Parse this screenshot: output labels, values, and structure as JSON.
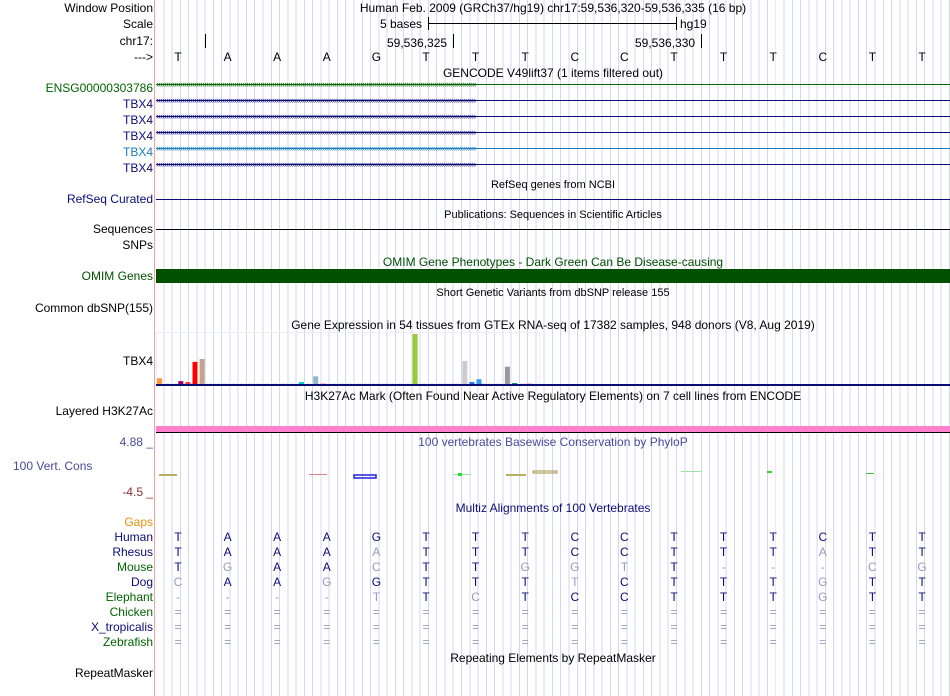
{
  "header": {
    "window_position_label": "Window Position",
    "position_text": "Human Feb. 2009 (GRCh37/hg19)   chr17:59,536,320-59,536,335 (16 bp)",
    "scale_label": "Scale",
    "scale_text": "5 bases",
    "assembly": "hg19",
    "chrom_label": "chr17:",
    "tick1": "59,536,325",
    "tick2": "59,536,330",
    "strand_label": "--->"
  },
  "sequence": "TAAAGTTTCCTTTCTT",
  "gencode": {
    "title": "GENCODE V49lift37 (1 items filtered out)",
    "items": [
      {
        "name": "ENSG00000303786",
        "color": "#006400",
        "strand": "-"
      },
      {
        "name": "TBX4",
        "color": "#0c0c78",
        "strand": "+"
      },
      {
        "name": "TBX4",
        "color": "#0c0c78",
        "strand": "+"
      },
      {
        "name": "TBX4",
        "color": "#0c0c78",
        "strand": "+"
      },
      {
        "name": "TBX4",
        "color": "#1a7cc0",
        "strand": "+"
      },
      {
        "name": "TBX4",
        "color": "#0c0c78",
        "strand": "+"
      }
    ]
  },
  "refseq": {
    "title": "RefSeq genes from NCBI",
    "label": "RefSeq Curated"
  },
  "publications": {
    "title": "Publications: Sequences in Scientific Articles",
    "label": "Sequences"
  },
  "snps": {
    "label": "SNPs"
  },
  "omim": {
    "title": "OMIM Gene Phenotypes - Dark Green Can Be Disease-causing",
    "label": "OMIM Genes",
    "color": "#005000"
  },
  "dbsnp": {
    "title": "Short Genetic Variants from dbSNP release 155",
    "label": "Common dbSNP(155)"
  },
  "gtex": {
    "title": "Gene Expression in 54 tissues from GTEx RNA-seq of 17382 samples, 948 donors (V8, Aug 2019)",
    "label": "TBX4"
  },
  "chart_data": {
    "type": "bar",
    "title": "Gene Expression in 54 tissues from GTEx RNA-seq",
    "bars": [
      {
        "i": 0,
        "v": 6,
        "c": "#ff9933"
      },
      {
        "i": 3,
        "v": 3,
        "c": "#990066"
      },
      {
        "i": 4,
        "v": 2,
        "c": "#ff3333"
      },
      {
        "i": 5,
        "v": 23,
        "c": "#ff0000"
      },
      {
        "i": 6,
        "v": 26,
        "c": "#c4a48c"
      },
      {
        "i": 20,
        "v": 2,
        "c": "#00cccc"
      },
      {
        "i": 22,
        "v": 8,
        "c": "#8fb8c8"
      },
      {
        "i": 23,
        "v": 1,
        "c": "#ffb6c1"
      },
      {
        "i": 36,
        "v": 52,
        "c": "#99cc33"
      },
      {
        "i": 43,
        "v": 24,
        "c": "#cccccc"
      },
      {
        "i": 44,
        "v": 2,
        "c": "#3366ff"
      },
      {
        "i": 45,
        "v": 5,
        "c": "#3399ff"
      },
      {
        "i": 49,
        "v": 18,
        "c": "#999999"
      },
      {
        "i": 50,
        "v": 1,
        "c": "#009966"
      },
      {
        "i": 52,
        "v": 1,
        "c": "#ffc0cb"
      }
    ]
  },
  "h3k27ac": {
    "title": "H3K27Ac Mark (Often Found Near Active Regulatory Elements) on 7 cell lines from ENCODE",
    "label": "Layered H3K27Ac",
    "color": "#ff80cc"
  },
  "phylop": {
    "title": "100 vertebrates Basewise Conservation by PhyloP",
    "label": "100 Vert. Cons",
    "ymax": "4.88 _",
    "ymin": "-4.5 _"
  },
  "multiz": {
    "title": "Multiz Alignments of 100 Vertebrates",
    "gaps_label": "Gaps",
    "rows": [
      {
        "name": "Human",
        "color": "#0c0c78",
        "bases": "TAAAGTTTCCTTTCTT",
        "dim": "0000000000000000"
      },
      {
        "name": "Rhesus",
        "color": "#0c0c78",
        "bases": "TAAAATTTCCTTTATT",
        "dim": "0000100000000100"
      },
      {
        "name": "Mouse",
        "color": "#006400",
        "bases": "TGAACTTGGTT---CG",
        "dim": "0100100111011111"
      },
      {
        "name": "Dog",
        "color": "#0c0c78",
        "bases": "CAAGGTTTTCTTTGTT",
        "dim": "1001000010000100"
      },
      {
        "name": "Elephant",
        "color": "#006400",
        "bases": "----TTCTCCTTTGTT",
        "dim": "1111101000000100"
      },
      {
        "name": "Chicken",
        "color": "#006400",
        "bases": "================",
        "dim": "1111111111111111"
      },
      {
        "name": "X_tropicalis",
        "color": "#0c0c78",
        "bases": "================",
        "dim": "1111111111111111"
      },
      {
        "name": "Zebrafish",
        "color": "#006400",
        "bases": "================",
        "dim": "1111111111111111"
      }
    ]
  },
  "repeatmasker": {
    "title": "Repeating Elements by RepeatMasker",
    "label": "RepeatMasker"
  }
}
